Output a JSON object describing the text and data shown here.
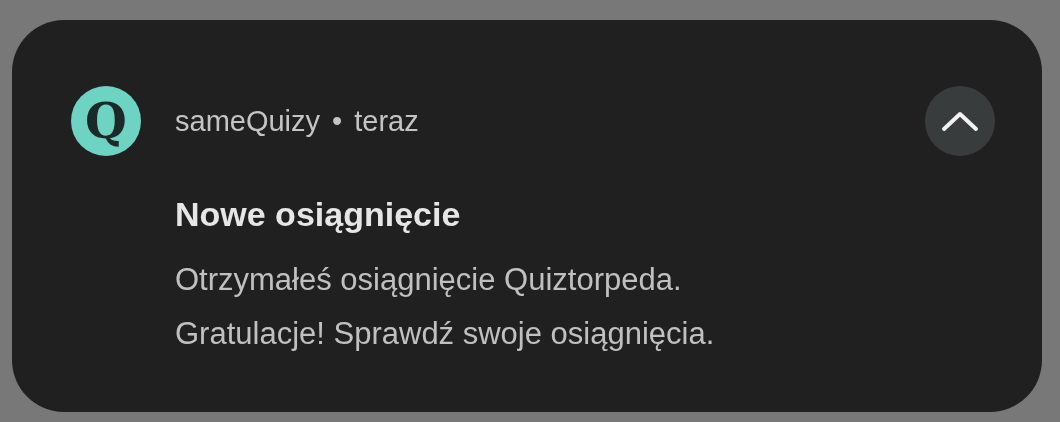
{
  "notification": {
    "app_icon_letter": "Q",
    "app_name": "sameQuizy",
    "separator": "•",
    "time": "teraz",
    "expanded": true,
    "title": "Nowe osiągnięcie",
    "body_lines": [
      "Otrzymałeś osiągnięcie Quiztorpeda.",
      "Gratulacje! Sprawdź swoje osiągnięcia."
    ]
  }
}
